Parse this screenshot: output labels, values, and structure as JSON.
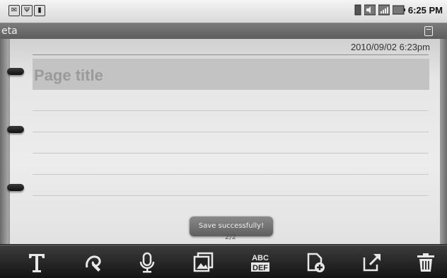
{
  "statusbar": {
    "left_icons": [
      "mail-icon",
      "usb-icon",
      "sd-card-icon"
    ],
    "right_icons": [
      "sim-icon",
      "mute-icon",
      "signal-icon",
      "battery-icon"
    ],
    "time": "6:25 PM"
  },
  "app": {
    "title": "eta"
  },
  "page": {
    "timestamp": "2010/09/02  6:23pm",
    "title_placeholder": "Page title",
    "page_indicator": "2/2"
  },
  "toast": {
    "message": "Save successfully!"
  },
  "toolbar": {
    "tools": [
      {
        "name": "text-tool",
        "icon": "text-icon"
      },
      {
        "name": "handwriting-tool",
        "icon": "pen-icon"
      },
      {
        "name": "voice-tool",
        "icon": "microphone-icon"
      },
      {
        "name": "image-tool",
        "icon": "picture-icon"
      },
      {
        "name": "keyboard-tool",
        "icon": "abc-def-icon",
        "label_top": "ABC",
        "label_bottom": "DEF"
      },
      {
        "name": "new-page-tool",
        "icon": "add-page-icon"
      },
      {
        "name": "export-tool",
        "icon": "export-icon"
      },
      {
        "name": "delete-tool",
        "icon": "trash-icon"
      }
    ]
  },
  "colors": {
    "paper": "#e9e9e9",
    "title_band": "#c3c3c3",
    "toolbar": "#1c1c1c",
    "toast": "#6f6f6f"
  }
}
